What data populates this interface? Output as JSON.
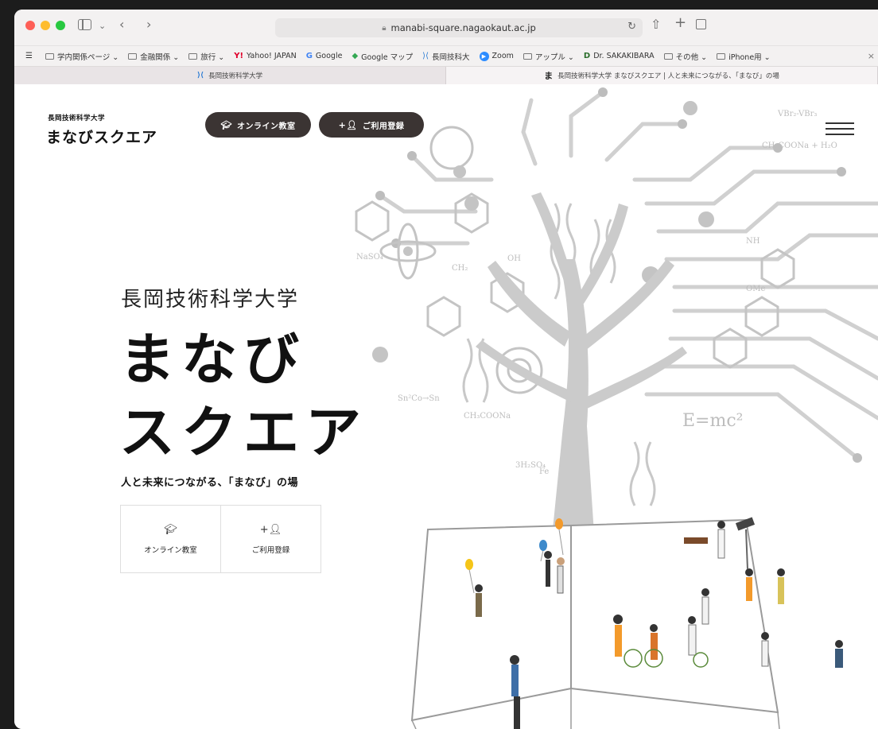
{
  "browser": {
    "url": "manabi-square.nagaokaut.ac.jp",
    "bookmarks": [
      {
        "label": "学内関係ページ ⌄",
        "icon": "folder-icon"
      },
      {
        "label": "金融関係 ⌄",
        "icon": "folder-icon"
      },
      {
        "label": "旅行 ⌄",
        "icon": "folder-icon"
      },
      {
        "label": "Yahoo! JAPAN",
        "icon": "yahoo-icon"
      },
      {
        "label": "Google",
        "icon": "google-icon"
      },
      {
        "label": "Google マップ",
        "icon": "map-pin-icon"
      },
      {
        "label": "長岡技科大",
        "icon": "university-icon"
      },
      {
        "label": "Zoom",
        "icon": "zoom-icon"
      },
      {
        "label": "アップル ⌄",
        "icon": "folder-icon"
      },
      {
        "label": "Dr. SAKAKIBARA",
        "icon": "profile-icon"
      },
      {
        "label": "その他 ⌄",
        "icon": "folder-icon"
      },
      {
        "label": "iPhone用 ⌄",
        "icon": "folder-icon"
      }
    ],
    "tabs": [
      {
        "title": "長岡技術科学大学",
        "active": false
      },
      {
        "title": "長岡技術科学大学 まなびスクエア | 人と未来につながる、「まなび」の場",
        "active": true
      }
    ]
  },
  "header": {
    "logo_small": "長岡技術科学大学",
    "logo_main": "まなびスクエア",
    "online_button": "オンライン教室",
    "register_button": "ご利用登録"
  },
  "hero": {
    "subtitle": "長岡技術科学大学",
    "title_line1": "まなび",
    "title_line2": "スクエア",
    "tagline": "人と未来につながる、「まなび」の場",
    "cta_online": "オンライン教室",
    "cta_register": "ご利用登録"
  },
  "illustration": {
    "formula_1": "E=mc²",
    "formula_2": "CH₃COONa + H₂O",
    "formula_3": "NaSO₄",
    "formula_4": "3H₂SO₄",
    "formula_5": "VBr₂-VBr₃",
    "formula_6": "CH₃COONa",
    "formula_7": "OMe",
    "formula_8": "NH",
    "formula_9": "OH",
    "formula_10": "Fe",
    "formula_11": "CH₂",
    "formula_12": "Sn²Co→Sn"
  },
  "colors": {
    "pill_bg": "#3b3433",
    "tree": "#c9c9c9",
    "formula": "#bdbdbd"
  }
}
